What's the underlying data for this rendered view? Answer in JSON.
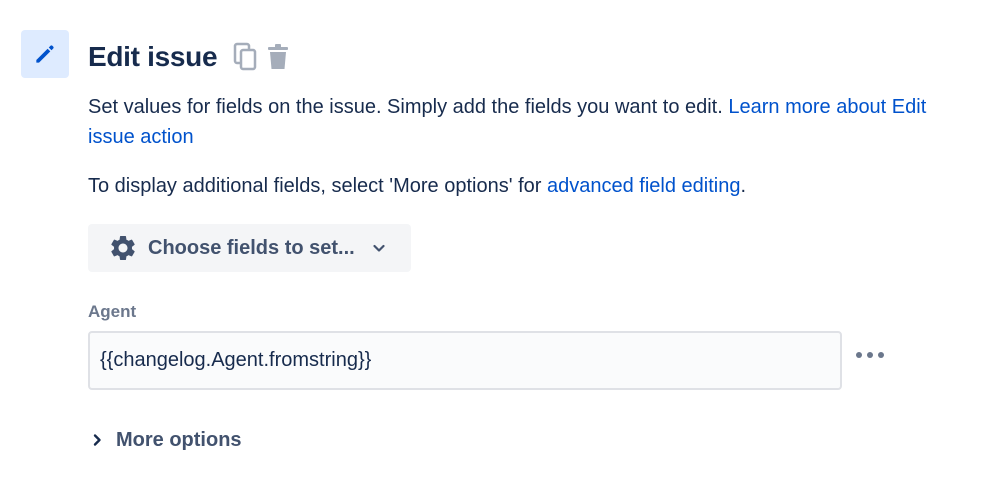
{
  "header": {
    "title": "Edit issue",
    "icons": [
      "pencil-icon",
      "copy-icon",
      "trash-icon"
    ]
  },
  "description": {
    "text": "Set values for fields on the issue. Simply add the fields you want to edit. ",
    "link": "Learn more about Edit issue action"
  },
  "additional": {
    "text_before": "To display additional fields, select 'More options' for ",
    "link": "advanced field editing",
    "text_after": "."
  },
  "choose_fields": {
    "label": "Choose fields to set...",
    "icon": "gear-icon"
  },
  "agent_field": {
    "label": "Agent",
    "value": "{{changelog.Agent.fromstring}}"
  },
  "more_options": {
    "label": "More options"
  },
  "colors": {
    "text": "#172b4d",
    "link": "#0052cc",
    "subtle": "#42526e",
    "icon_bg": "#deebff",
    "accent": "#0052cc"
  }
}
